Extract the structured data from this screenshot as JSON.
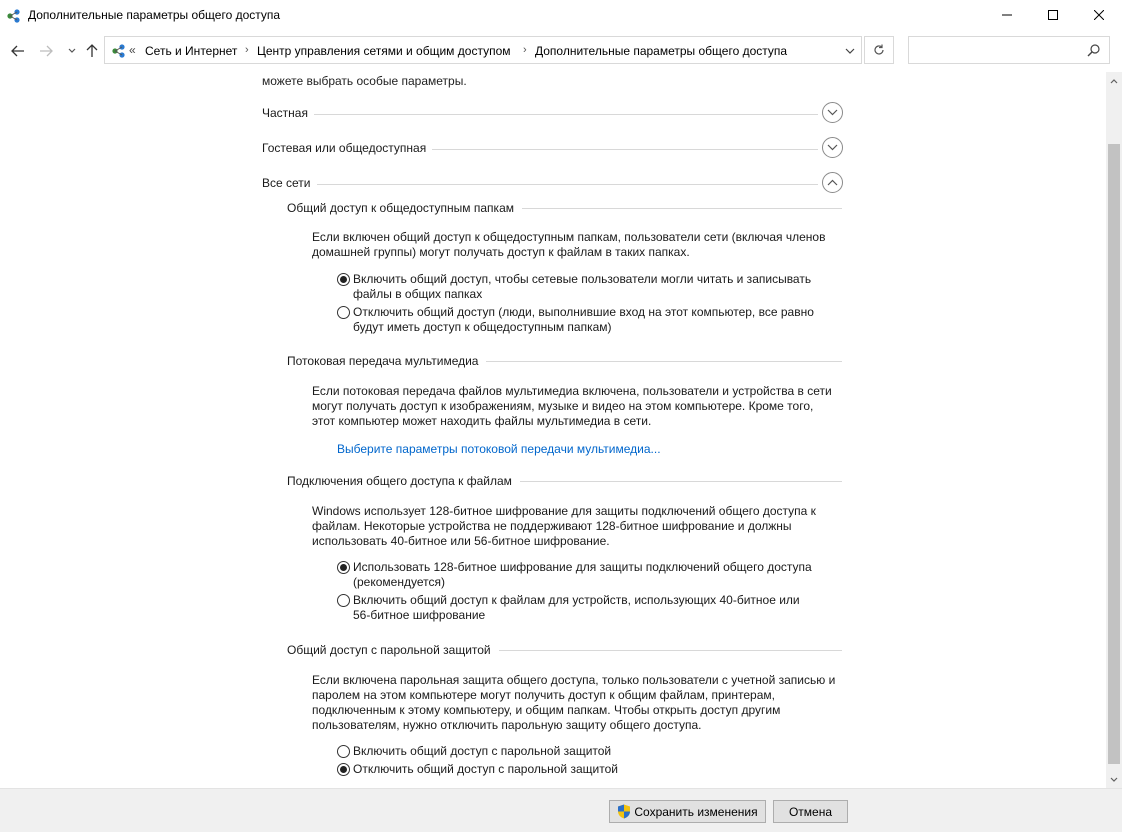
{
  "window": {
    "title": "Дополнительные параметры общего доступа"
  },
  "address": {
    "overflow": "«",
    "crumbs": [
      "Сеть и Интернет",
      "Центр управления сетями и общим доступом",
      "Дополнительные параметры общего доступа"
    ],
    "search_placeholder": ""
  },
  "content": {
    "intro_tail": "можете выбрать особые параметры.",
    "groups": [
      {
        "label": "Частная",
        "expanded": false
      },
      {
        "label": "Гостевая или общедоступная",
        "expanded": false
      },
      {
        "label": "Все сети",
        "expanded": true
      }
    ],
    "public_folders": {
      "title": "Общий доступ к общедоступным папкам",
      "desc_lines": [
        "Если включен общий доступ к общедоступным папкам, пользователи сети (включая членов",
        "домашней группы) могут получать доступ к файлам в таких папках."
      ],
      "options": [
        {
          "line1": "Включить общий доступ, чтобы сетевые пользователи могли читать и записывать",
          "line2": "файлы в общих папках",
          "checked": true
        },
        {
          "line1": "Отключить общий доступ (люди, выполнившие вход на этот компьютер, все равно",
          "line2": "будут иметь доступ к общедоступным папкам)",
          "checked": false
        }
      ]
    },
    "media": {
      "title": "Потоковая передача мультимедиа",
      "desc_lines": [
        "Если потоковая передача файлов мультимедиа включена, пользователи и устройства в сети",
        "могут получать доступ к изображениям, музыке и видео на этом компьютере. Кроме того,",
        "этот компьютер может находить файлы мультимедиа в сети."
      ],
      "link": "Выберите параметры потоковой передачи мультимедиа..."
    },
    "file_sharing": {
      "title": "Подключения общего доступа к файлам",
      "desc_lines": [
        "Windows использует 128-битное шифрование для защиты подключений общего доступа к",
        "файлам. Некоторые устройства не поддерживают 128-битное шифрование и должны",
        "использовать 40-битное или 56-битное шифрование."
      ],
      "options": [
        {
          "line1": "Использовать 128-битное шифрование для защиты подключений общего доступа",
          "line2": "(рекомендуется)",
          "checked": true
        },
        {
          "line1": "Включить общий доступ к файлам для устройств, использующих 40-битное или",
          "line2": "56-битное шифрование",
          "checked": false
        }
      ]
    },
    "password": {
      "title": "Общий доступ с парольной защитой",
      "desc_lines": [
        "Если включена парольная защита общего доступа, только пользователи с учетной записью и",
        "паролем на этом компьютере могут получить доступ к общим файлам, принтерам,",
        "подключенным к этому компьютеру, и общим папкам. Чтобы открыть доступ другим",
        "пользователям, нужно отключить парольную защиту общего доступа."
      ],
      "options": [
        {
          "line1": "Включить общий доступ с парольной защитой",
          "checked": false
        },
        {
          "line1": "Отключить общий доступ с парольной защитой",
          "checked": true
        }
      ]
    }
  },
  "footer": {
    "save_label": "Сохранить изменения",
    "cancel_label": "Отмена"
  },
  "colors": {
    "link": "#0066cc",
    "footer_bg": "#f0f0f0"
  },
  "icons": [
    "network-icon",
    "minimize-icon",
    "maximize-icon",
    "close-icon",
    "back-arrow-icon",
    "forward-arrow-icon",
    "chevron-down-icon",
    "up-arrow-icon",
    "refresh-icon",
    "search-icon",
    "expand-chevron-icon",
    "collapse-chevron-icon",
    "uac-shield-icon"
  ]
}
